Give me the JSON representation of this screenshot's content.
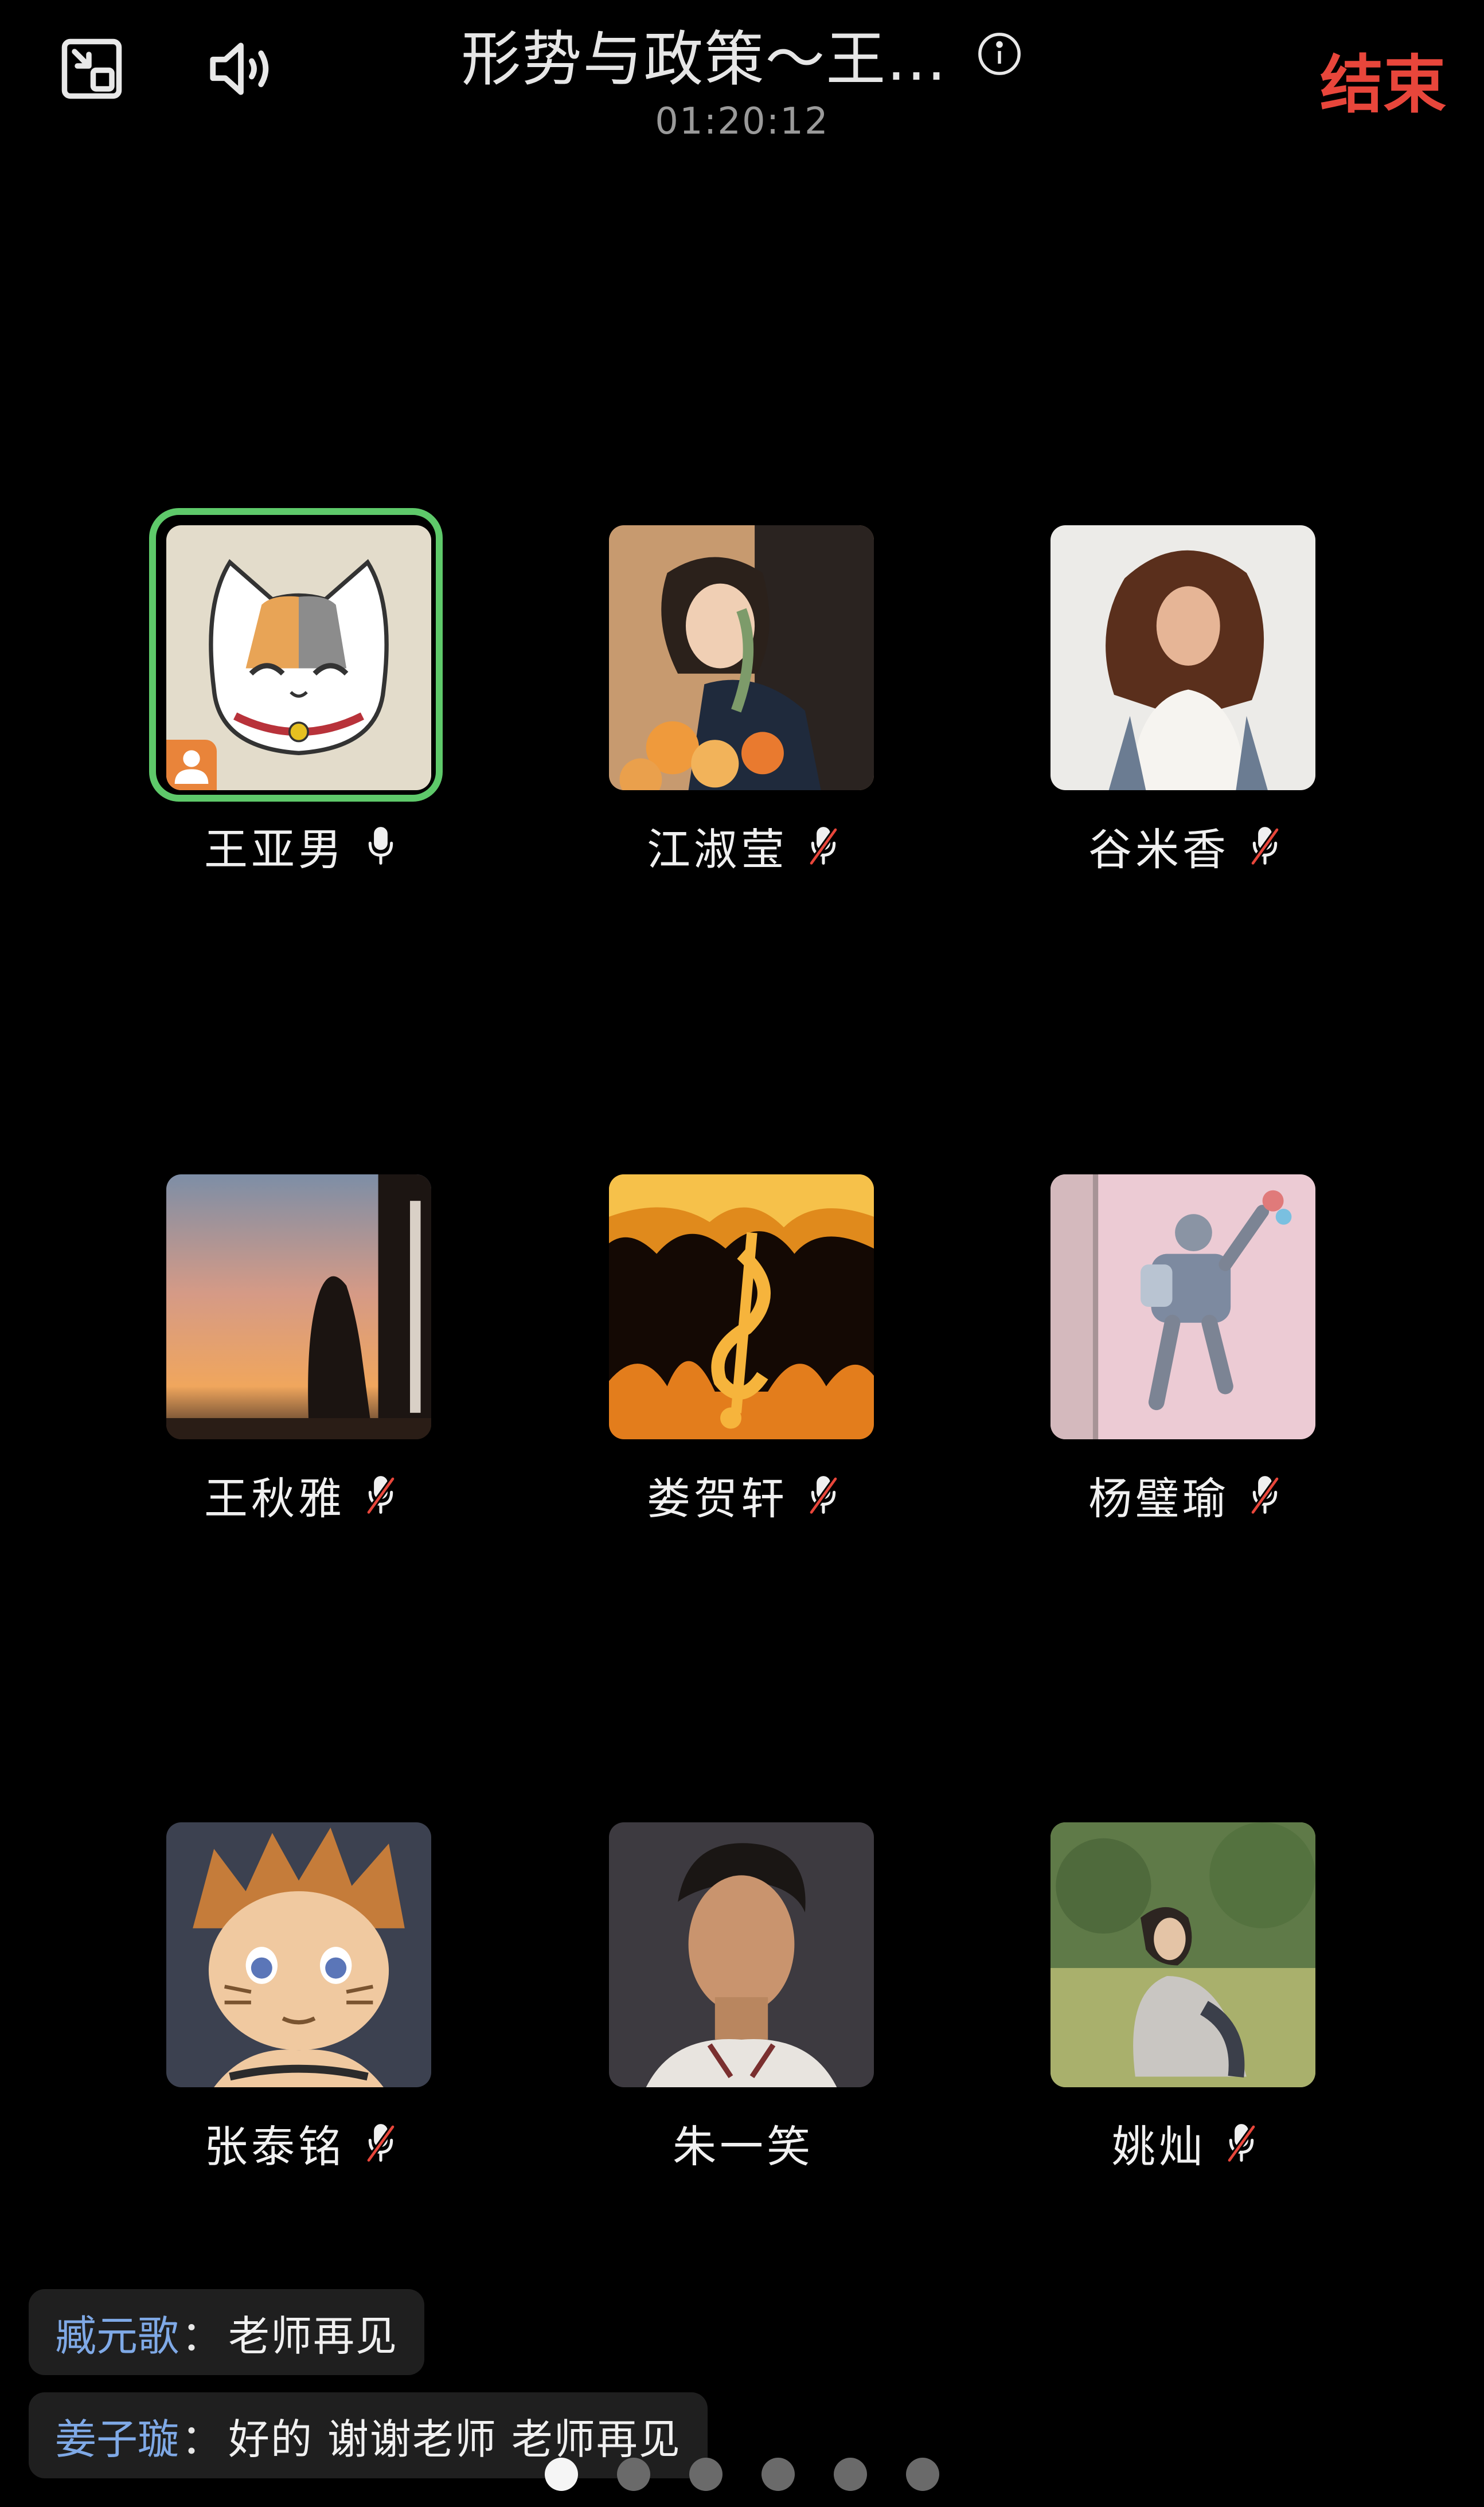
{
  "header": {
    "title": "形势与政策～王...",
    "timer": "01:20:12",
    "end_label": "结束",
    "icons": [
      "exit-fullscreen-icon",
      "speaker-icon",
      "info-icon"
    ]
  },
  "participants": [
    {
      "name": "王亚男",
      "mic": "on",
      "host": true,
      "avatar": "cartoon-cat"
    },
    {
      "name": "江淑莹",
      "mic": "off",
      "avatar": "photo-woman-flowers"
    },
    {
      "name": "谷米香",
      "mic": "off",
      "avatar": "photo-woman-curly-hair"
    },
    {
      "name": "王秋雅",
      "mic": "off",
      "avatar": "silhouette-sunset"
    },
    {
      "name": "娄贺轩",
      "mic": "off",
      "avatar": "flaming-treble-clef"
    },
    {
      "name": "杨璧瑜",
      "mic": "off",
      "avatar": "jumping-figure"
    },
    {
      "name": "张泰铭",
      "mic": "off",
      "avatar": "anime-boy"
    },
    {
      "name": "朱一笑",
      "mic": "none",
      "avatar": "photo-man-curly-hair"
    },
    {
      "name": "姚灿",
      "mic": "off",
      "avatar": "photo-girl-grass"
    }
  ],
  "chat": [
    {
      "sender": "臧元歌",
      "sep": "：",
      "message": "老师再见"
    },
    {
      "sender": "姜子璇",
      "sep": "：",
      "message": "好的 谢谢老师 老师再见"
    }
  ],
  "pager": {
    "pages": 6,
    "current": 1
  },
  "colors": {
    "end": "#e8463b",
    "host_ring": "#5ec96a",
    "host_badge": "#e9843a",
    "chat_name": "#7fa9e6",
    "muted_slash": "#e8463b"
  }
}
